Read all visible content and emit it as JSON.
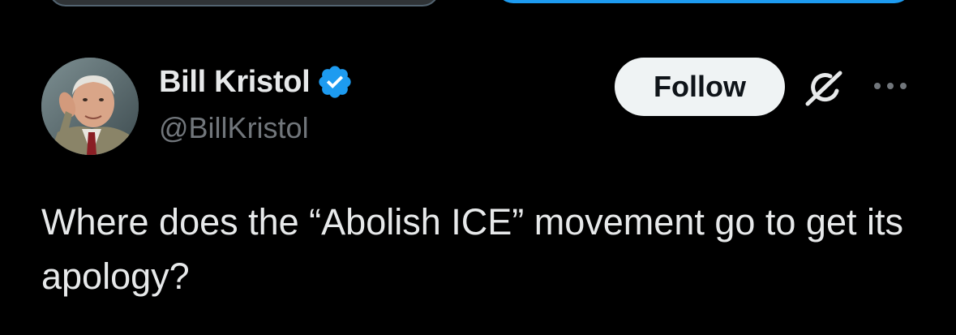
{
  "author": {
    "display_name": "Bill Kristol",
    "handle": "@BillKristol",
    "verified": true,
    "verified_icon": "verified-badge-icon",
    "avatar_icon": "profile-photo"
  },
  "actions": {
    "follow_label": "Follow",
    "grok_icon": "grok-icon",
    "more_icon": "more-options-icon"
  },
  "tweet": {
    "text": "Where does the “Abolish ICE” movement go to get its apology?"
  },
  "colors": {
    "background": "#000000",
    "text_primary": "#e7e9ea",
    "text_secondary": "#71767b",
    "verified_blue": "#1d9bf0",
    "follow_bg": "#eff3f4",
    "follow_text": "#0f1419"
  }
}
